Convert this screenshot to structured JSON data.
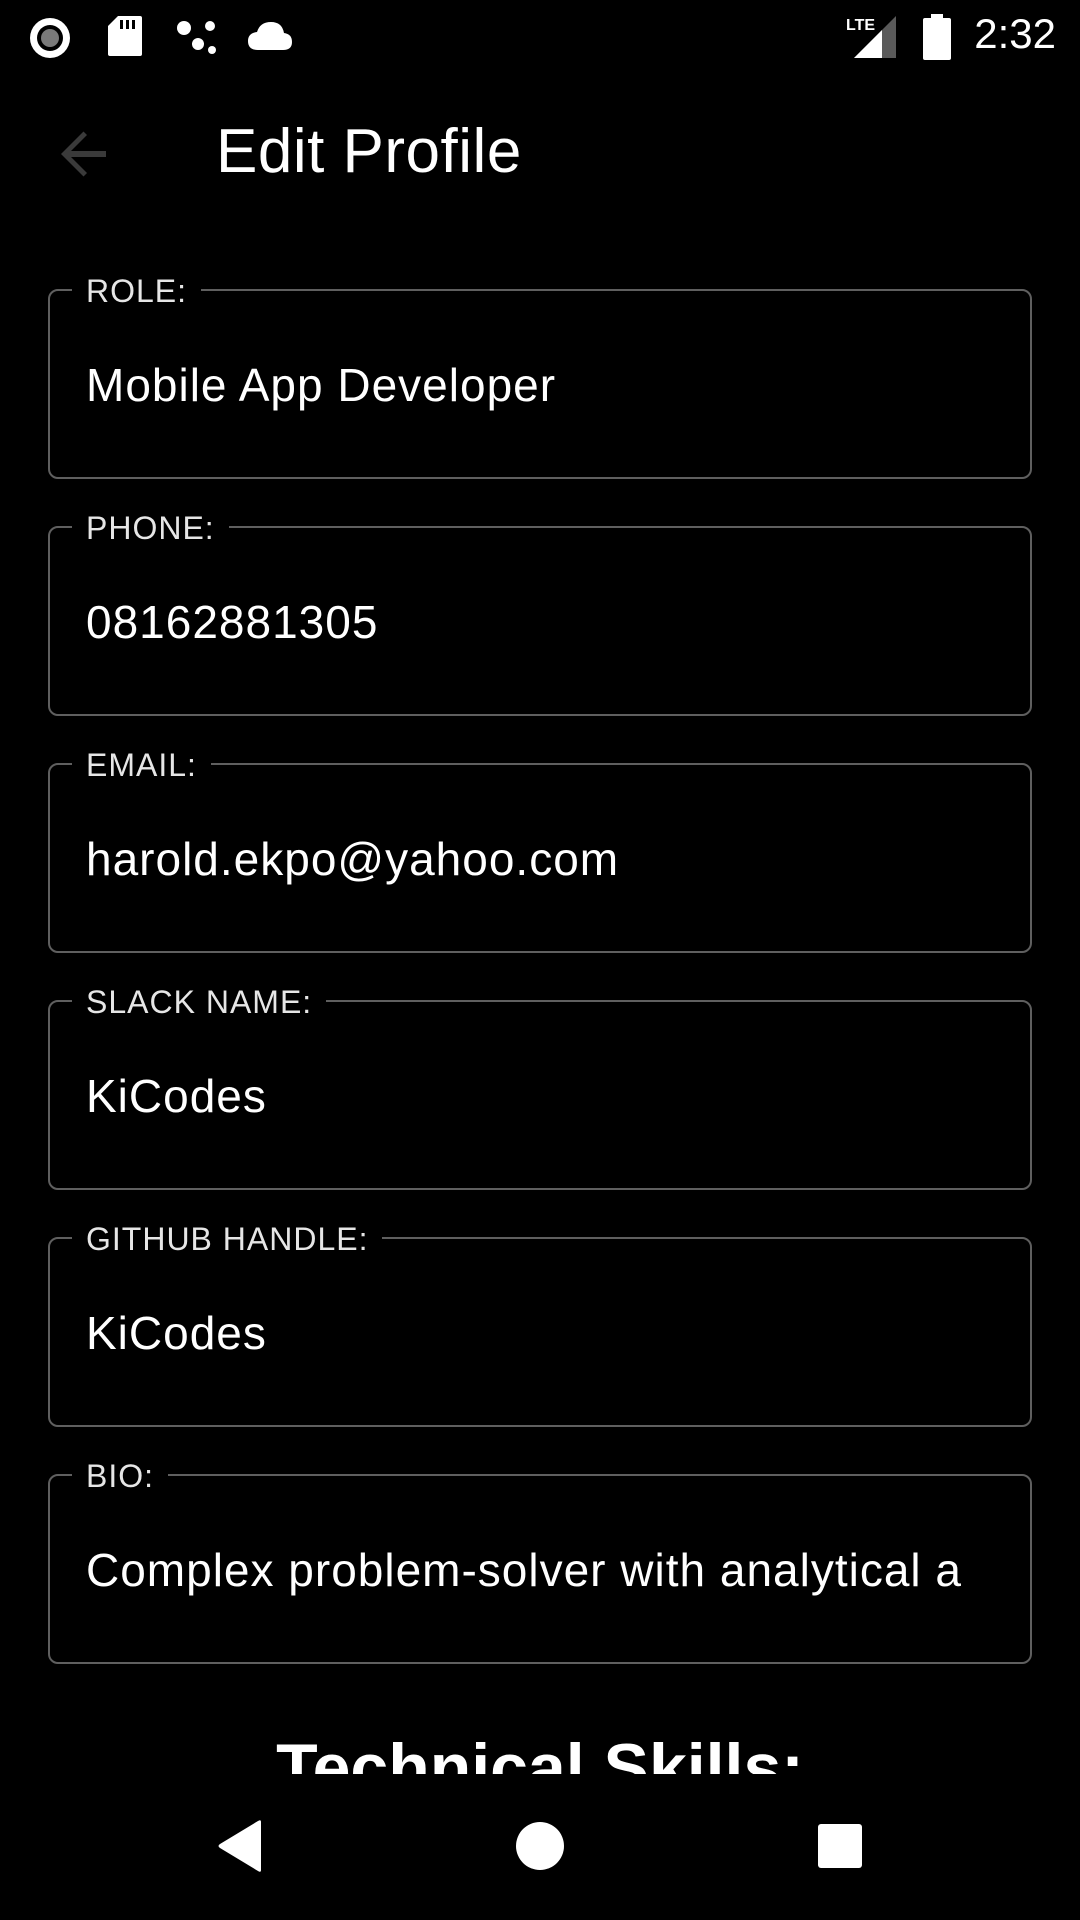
{
  "status_bar": {
    "time": "2:32",
    "network_label": "LTE",
    "icons": [
      "record-icon",
      "sd-card-icon",
      "assistant-dots-icon",
      "cloud-icon",
      "lte-signal-icon",
      "battery-icon"
    ]
  },
  "app_bar": {
    "title": "Edit Profile",
    "back_icon": "arrow-back-icon"
  },
  "fields": [
    {
      "label": "ROLE:",
      "value": "Mobile App Developer"
    },
    {
      "label": "PHONE:",
      "value": "08162881305"
    },
    {
      "label": "EMAIL:",
      "value": "harold.ekpo@yahoo.com"
    },
    {
      "label": "SLACK NAME:",
      "value": "KiCodes"
    },
    {
      "label": "GITHUB HANDLE:",
      "value": "KiCodes"
    },
    {
      "label": "BIO:",
      "value": "Complex problem-solver with analytical a"
    }
  ],
  "section": {
    "heading": "Technical Skills:"
  },
  "nav_bar": {
    "icons": [
      "nav-back-icon",
      "nav-home-icon",
      "nav-recents-icon"
    ]
  },
  "colors": {
    "background": "#000000",
    "text": "#ffffff",
    "field_border": "#5f5f5f",
    "back_icon": "#3a3a3a"
  }
}
